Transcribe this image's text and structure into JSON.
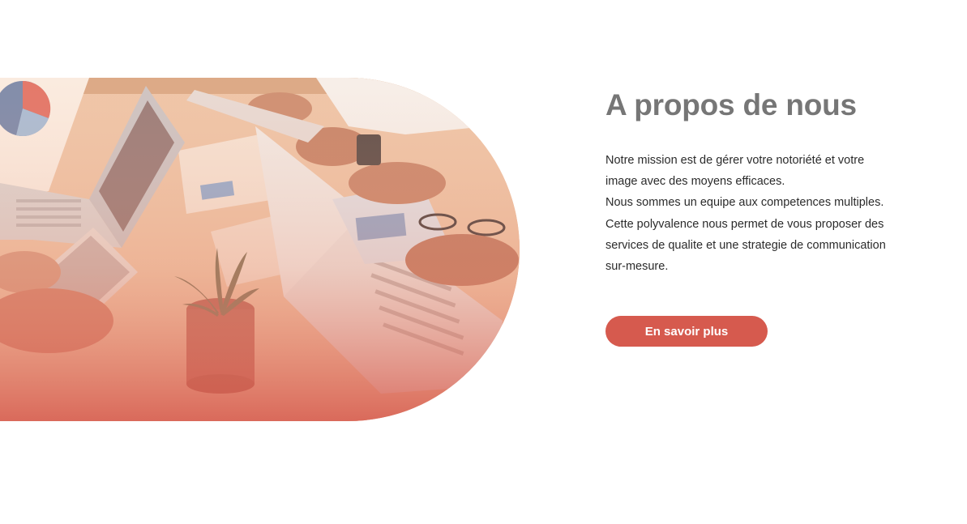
{
  "about": {
    "title": "A propos de nous",
    "description_lines": [
      "Notre mission est de gérer votre notoriété et votre",
      "image avec des moyens efficaces.",
      "Nous sommes un equipe aux competences multiples.",
      "Cette polyvalence nous permet de vous proposer des",
      "services de qualite et une strategie de communication",
      "sur-mesure."
    ],
    "cta_label": "En savoir plus"
  },
  "colors": {
    "accent": "#d65a4e",
    "title": "#767676",
    "text": "#2b2b2b",
    "background": "#ffffff"
  }
}
